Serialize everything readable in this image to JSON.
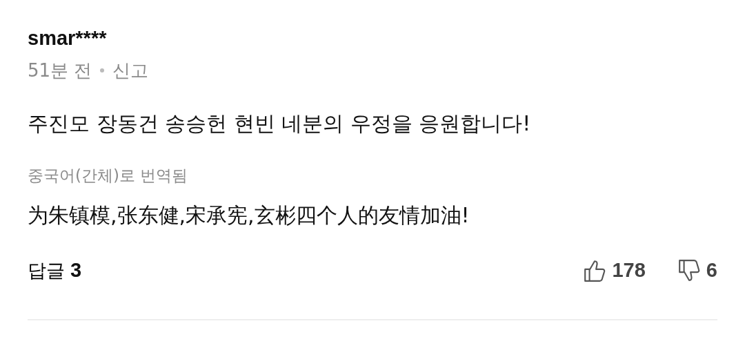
{
  "comment": {
    "username": "smar****",
    "time": "51분 전",
    "report": "신고",
    "text": "주진모 장동건 송승헌 현빈 네분의 우정을 응원합니다!",
    "translation_note": "중국어(간체)로 번역됨",
    "translation": "为朱镇模,张东健,宋承宪,玄彬四个人的友情加油!",
    "replies_label": "답글",
    "replies_count": "3",
    "likes": "178",
    "dislikes": "6"
  }
}
